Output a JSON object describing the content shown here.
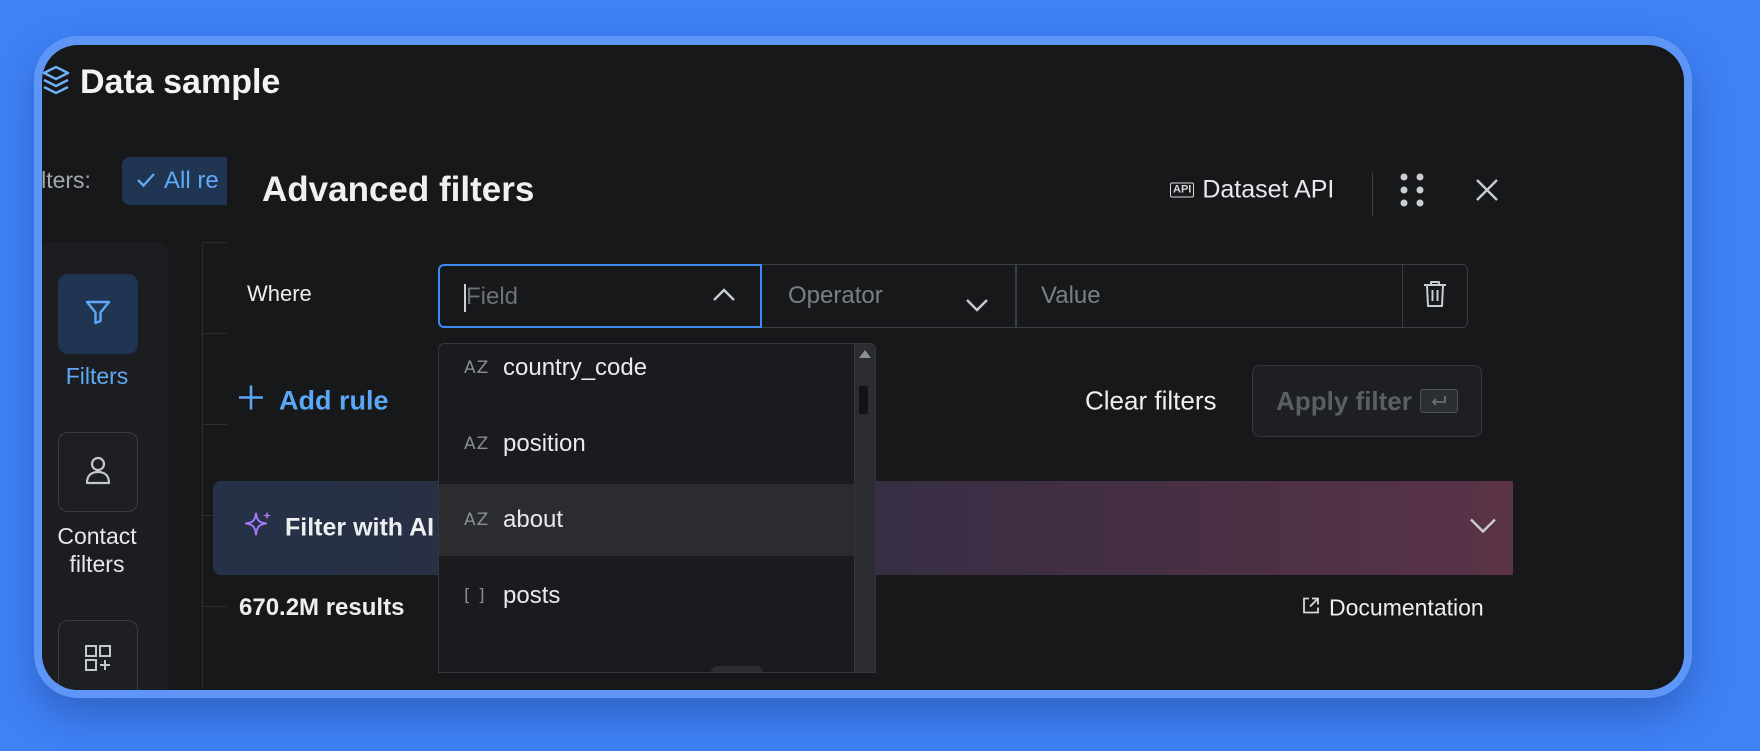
{
  "app": {
    "title": "Data sample"
  },
  "topbar": {
    "filters_label": "ilters:",
    "chip_label": "All re"
  },
  "leftnav": {
    "items": [
      {
        "label": "Filters"
      },
      {
        "label_line1": "Contact",
        "label_line2": "filters"
      }
    ]
  },
  "modal": {
    "title": "Advanced filters",
    "dataset_api_label": "Dataset API",
    "api_badge": "API",
    "rule": {
      "where_label": "Where",
      "field_placeholder": "Field",
      "operator_placeholder": "Operator",
      "value_placeholder": "Value"
    },
    "add_rule_label": "Add rule",
    "clear_filters_label": "Clear filters",
    "apply_filter_label": "Apply filter",
    "ai_label": "Filter with AI",
    "results_label": "670.2M results",
    "documentation_label": "Documentation"
  },
  "field_dropdown": {
    "items": [
      {
        "type": "AZ",
        "name": "country_code",
        "highlighted": false
      },
      {
        "type": "AZ",
        "name": "position",
        "highlighted": false
      },
      {
        "type": "AZ",
        "name": "about",
        "highlighted": true
      },
      {
        "type": "[ ]",
        "name": "posts",
        "highlighted": false
      }
    ]
  },
  "colors": {
    "background": "#3f82f6",
    "panel": "#17181a",
    "accent": "#5aa7f5",
    "focus_border": "#3d8af7"
  }
}
